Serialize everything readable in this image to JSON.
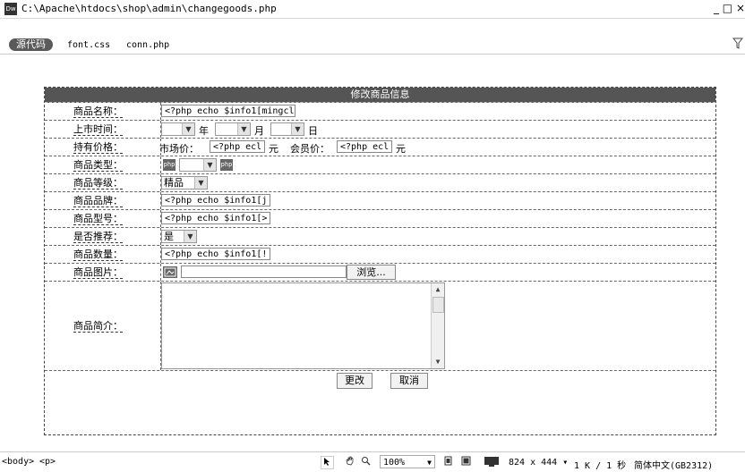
{
  "window": {
    "app_icon": "Dw",
    "title": "C:\\Apache\\htdocs\\shop\\admin\\changegoods.php",
    "controls": [
      "_",
      "□",
      "×"
    ]
  },
  "related_files": {
    "source_label": "源代码",
    "files": [
      "font.css",
      "conn.php"
    ],
    "filter_icon": "filter-icon"
  },
  "form": {
    "header": "修改商品信息",
    "rows": {
      "name": {
        "label": "商品名称：",
        "value": "<?php echo $info1[mingcl"
      },
      "date": {
        "label": "上市时间：",
        "year": "年",
        "month": "月",
        "day": "日"
      },
      "price": {
        "label": "持有价格：",
        "market_label": "市场价：",
        "market_value": "<?php ecl",
        "unit1": "元",
        "member_label": "会员价：",
        "member_value": "<?php ecl",
        "unit2": "元"
      },
      "type": {
        "label": "商品类型：",
        "php_badge": "php"
      },
      "grade": {
        "label": "商品等级：",
        "selected": "精品"
      },
      "brand": {
        "label": "商品品牌：",
        "value": "<?php echo $info1[j"
      },
      "model": {
        "label": "商品型号：",
        "value": "<?php echo $info1[>"
      },
      "recommend": {
        "label": "是否推荐：",
        "selected": "是"
      },
      "quantity": {
        "label": "商品数量：",
        "value": "<?php echo $info1[!"
      },
      "image": {
        "label": "商品图片：",
        "browse": "浏览..."
      },
      "intro": {
        "label": "商品简介："
      }
    },
    "buttons": {
      "submit": "更改",
      "cancel": "取消"
    }
  },
  "statusbar": {
    "tags": [
      "<body>",
      "<p>"
    ],
    "zoom": "100%",
    "dimensions": "824 x 444",
    "filesize": "1 K / 1 秒",
    "encoding": "简体中文(GB2312)"
  }
}
